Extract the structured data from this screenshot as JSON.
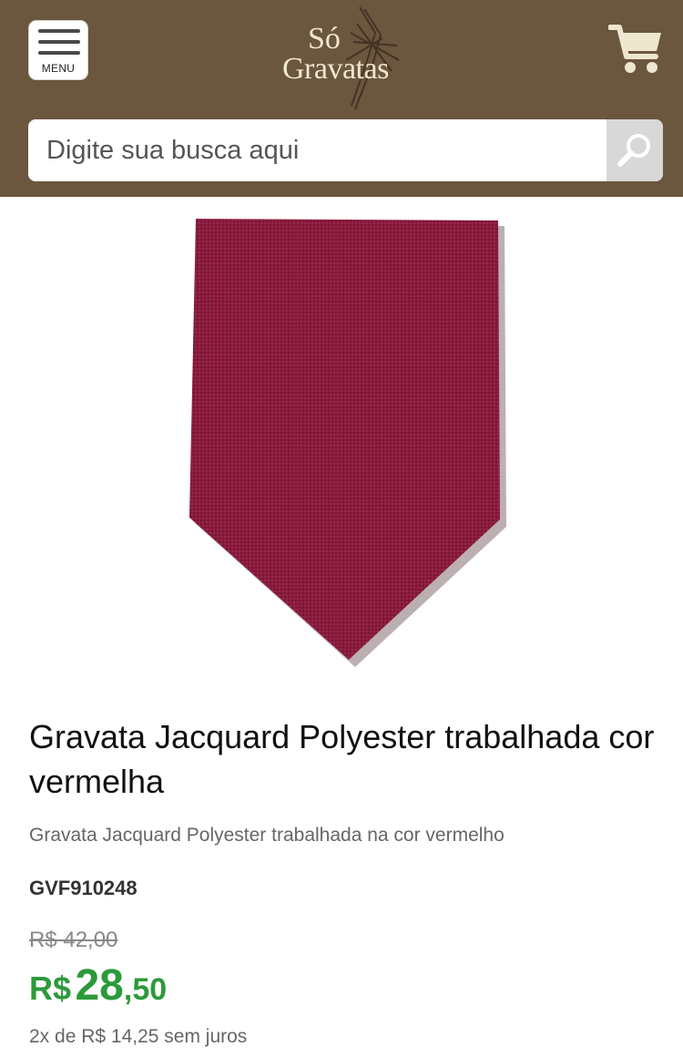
{
  "header": {
    "menu_label": "MENU",
    "logo_line1": "Só",
    "logo_line2": "Gravatas",
    "background_color": "#6b563e"
  },
  "search": {
    "placeholder": "Digite sua busca aqui",
    "value": ""
  },
  "product": {
    "image_color": "#8b1d3d",
    "title": "Gravata Jacquard Polyester trabalhada cor vermelha",
    "description": "Gravata Jacquard Polyester trabalhada na cor vermelho",
    "sku": "GVF910248",
    "old_price": "R$ 42,00",
    "price": {
      "currency": "R$",
      "integer": "28",
      "decimal": ",50"
    },
    "installments": "2x de R$ 14,25 sem juros",
    "price_color": "#2c9a3a"
  },
  "icons": {
    "menu": "hamburger-icon",
    "cart": "cart-icon",
    "search": "search-icon"
  }
}
